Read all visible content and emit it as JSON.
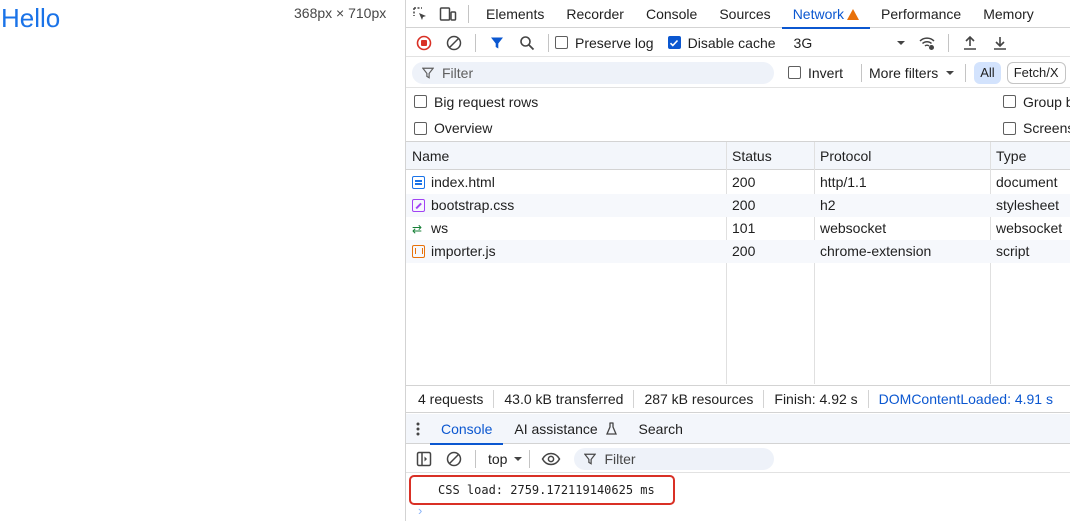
{
  "viewport": {
    "heading": "Hello",
    "dimensions": "368px × 710px"
  },
  "devtools": {
    "tabs": [
      "Elements",
      "Recorder",
      "Console",
      "Sources",
      "Network",
      "Performance",
      "Memory"
    ],
    "active_tab": "Network",
    "toolbar": {
      "preserve_log": {
        "label": "Preserve log",
        "checked": false
      },
      "disable_cache": {
        "label": "Disable cache",
        "checked": true
      },
      "throttling": "3G"
    },
    "filter": {
      "placeholder": "Filter",
      "invert_label": "Invert",
      "more_filters_label": "More filters",
      "type_all": "All",
      "type_fetch": "Fetch/X"
    },
    "options": {
      "big_request_rows": "Big request rows",
      "overview": "Overview",
      "group_by": "Group b",
      "screenshots": "Screens"
    },
    "table": {
      "columns": [
        "Name",
        "Status",
        "Protocol",
        "Type"
      ],
      "rows": [
        {
          "icon": "document-icon",
          "name": "index.html",
          "status": "200",
          "protocol": "http/1.1",
          "type": "document"
        },
        {
          "icon": "stylesheet-icon",
          "name": "bootstrap.css",
          "status": "200",
          "protocol": "h2",
          "type": "stylesheet"
        },
        {
          "icon": "websocket-icon",
          "name": "ws",
          "status": "101",
          "protocol": "websocket",
          "type": "websocket"
        },
        {
          "icon": "script-icon",
          "name": "importer.js",
          "status": "200",
          "protocol": "chrome-extension",
          "type": "script"
        }
      ]
    },
    "summary": {
      "requests": "4 requests",
      "transferred": "43.0 kB transferred",
      "resources": "287 kB resources",
      "finish": "Finish: 4.92 s",
      "dom_content_loaded": "DOMContentLoaded: 4.91 s"
    },
    "drawer": {
      "tabs": [
        "Console",
        "AI assistance",
        "Search"
      ],
      "active_tab": "Console",
      "context": "top",
      "filter_placeholder": "Filter",
      "log_message": "CSS load: 2759.172119140625 ms",
      "prompt": "›"
    },
    "colors": {
      "accent": "#0b57d0",
      "warning": "#e8710a",
      "highlight_border": "#d93025",
      "record_red": "#d93025"
    }
  }
}
